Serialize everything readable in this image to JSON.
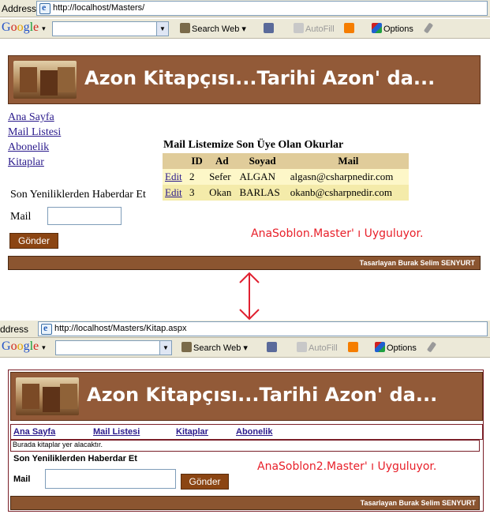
{
  "screen1": {
    "browser": {
      "address_label": "Address",
      "url": "http://localhost/Masters/",
      "toolbar": {
        "google": "Google",
        "search_web": "Search Web",
        "autofill": "AutoFill",
        "options": "Options"
      }
    },
    "banner_title": "Azon Kitapçısı...Tarihi Azon' da...",
    "nav": [
      "Ana Sayfa",
      "Mail Listesi",
      "Abonelik",
      "Kitaplar"
    ],
    "mail_table": {
      "caption": "Mail Listemize Son Üye Olan Okurlar",
      "headers": [
        "",
        "ID",
        "Ad",
        "Soyad",
        "Mail"
      ],
      "rows": [
        {
          "edit": "Edit",
          "id": "2",
          "ad": "Sefer",
          "soyad": "ALGAN",
          "mail": "algasn@csharpnedir.com"
        },
        {
          "edit": "Edit",
          "id": "3",
          "ad": "Okan",
          "soyad": "BARLAS",
          "mail": "okanb@csharpnedir.com"
        }
      ]
    },
    "subscribe": {
      "heading": "Son Yeniliklerden Haberdar Et",
      "mail_label": "Mail",
      "mail_value": "",
      "button": "Gönder"
    },
    "note": "AnaSoblon.Master' ı Uyguluyor.",
    "footer": "Tasarlayan Burak Selim SENYURT"
  },
  "screen2": {
    "browser": {
      "address_label": "ddress",
      "url": "http://localhost/Masters/Kitap.aspx",
      "toolbar": {
        "google": "Google",
        "search_web": "Search Web",
        "autofill": "AutoFill",
        "options": "Options"
      }
    },
    "banner_title": "Azon Kitapçısı...Tarihi Azon' da...",
    "nav": [
      "Ana Sayfa",
      "Mail Listesi",
      "Kitaplar",
      "Abonelik"
    ],
    "content_text": "Burada kitaplar yer alacaktır.",
    "subscribe": {
      "heading": "Son Yeniliklerden Haberdar Et",
      "mail_label": "Mail",
      "mail_value": "",
      "button": "Gönder"
    },
    "note": "AnaSoblon2.Master' ı Uyguluyor.",
    "footer": "Tasarlayan Burak Selim SENYURT"
  },
  "icons": {
    "ie_page": "ie-page-icon",
    "search_binoculars": "binoculars-icon",
    "news_icon": "news-icon",
    "autofill_icon": "autofill-icon",
    "blogger_icon": "blogger-icon",
    "options_icon": "options-icon",
    "pen_icon": "pen-icon",
    "connector_arrow": "double-arrow-icon"
  },
  "colors": {
    "banner": "#925a38",
    "button": "#8b4513",
    "note": "#e8202a",
    "table_header": "#e0cc9a",
    "table_row": "#fdf7c8",
    "arrow": "#e02030"
  }
}
